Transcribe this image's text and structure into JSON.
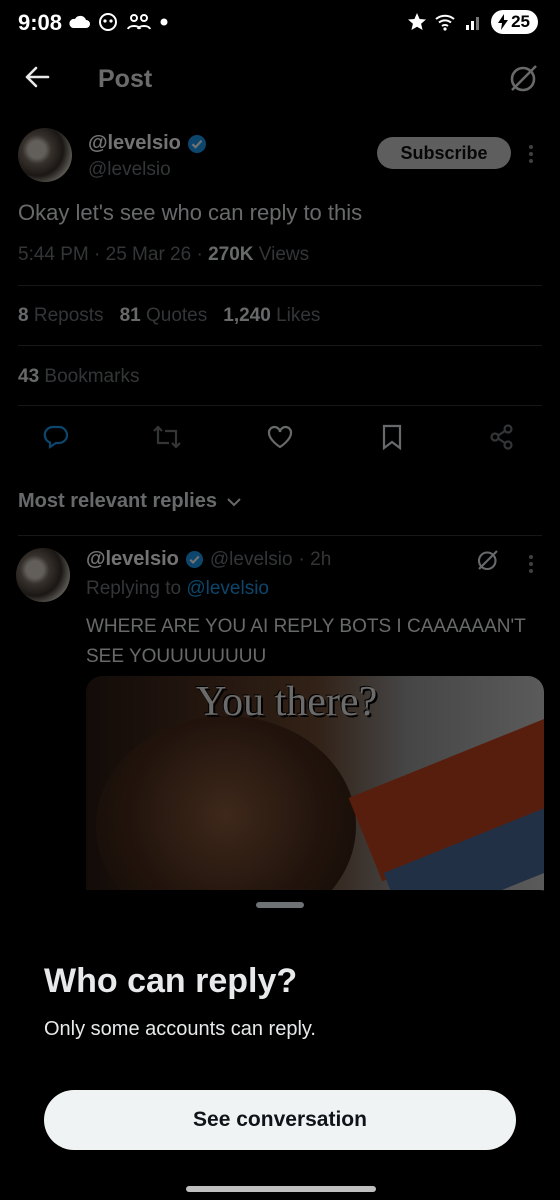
{
  "status_bar": {
    "time": "9:08",
    "battery": "25",
    "left_icons": [
      "cloud-icon",
      "face-icon",
      "people-icon",
      "dot-icon"
    ],
    "right_icons": [
      "star-icon",
      "wifi-icon",
      "signal-icon",
      "battery-icon"
    ]
  },
  "header": {
    "title": "Post"
  },
  "post": {
    "author_name": "@levelsio",
    "author_handle": "@levelsio",
    "subscribe_label": "Subscribe",
    "text": "Okay let's see who can reply to this",
    "timestamp": "5:44 PM · 25 Mar 26 · ",
    "views_count": "270K",
    "views_label": " Views",
    "reposts_count": "8",
    "reposts_label": " Reposts",
    "quotes_count": "81",
    "quotes_label": " Quotes",
    "likes_count": "1,240",
    "likes_label": " Likes",
    "bookmarks_count": "43",
    "bookmarks_label": " Bookmarks"
  },
  "replies_sort": {
    "label": "Most relevant replies"
  },
  "reply": {
    "author_name": "@levelsio",
    "author_handle": "@levelsio",
    "time": "· 2h",
    "replying_prefix": "Replying to ",
    "replying_to": "@levelsio",
    "text": "WHERE ARE YOU AI REPLY BOTS I CAAAAAAN'T SEE YOUUUUUUUU",
    "media_caption": "You there?"
  },
  "sheet": {
    "title": "Who can reply?",
    "subtitle": "Only some accounts can reply.",
    "button_label": "See conversation"
  },
  "colors": {
    "background": "#000000",
    "accent": "#1d9bf0",
    "verified": "#1d9bf0",
    "muted_text": "#71767b"
  }
}
